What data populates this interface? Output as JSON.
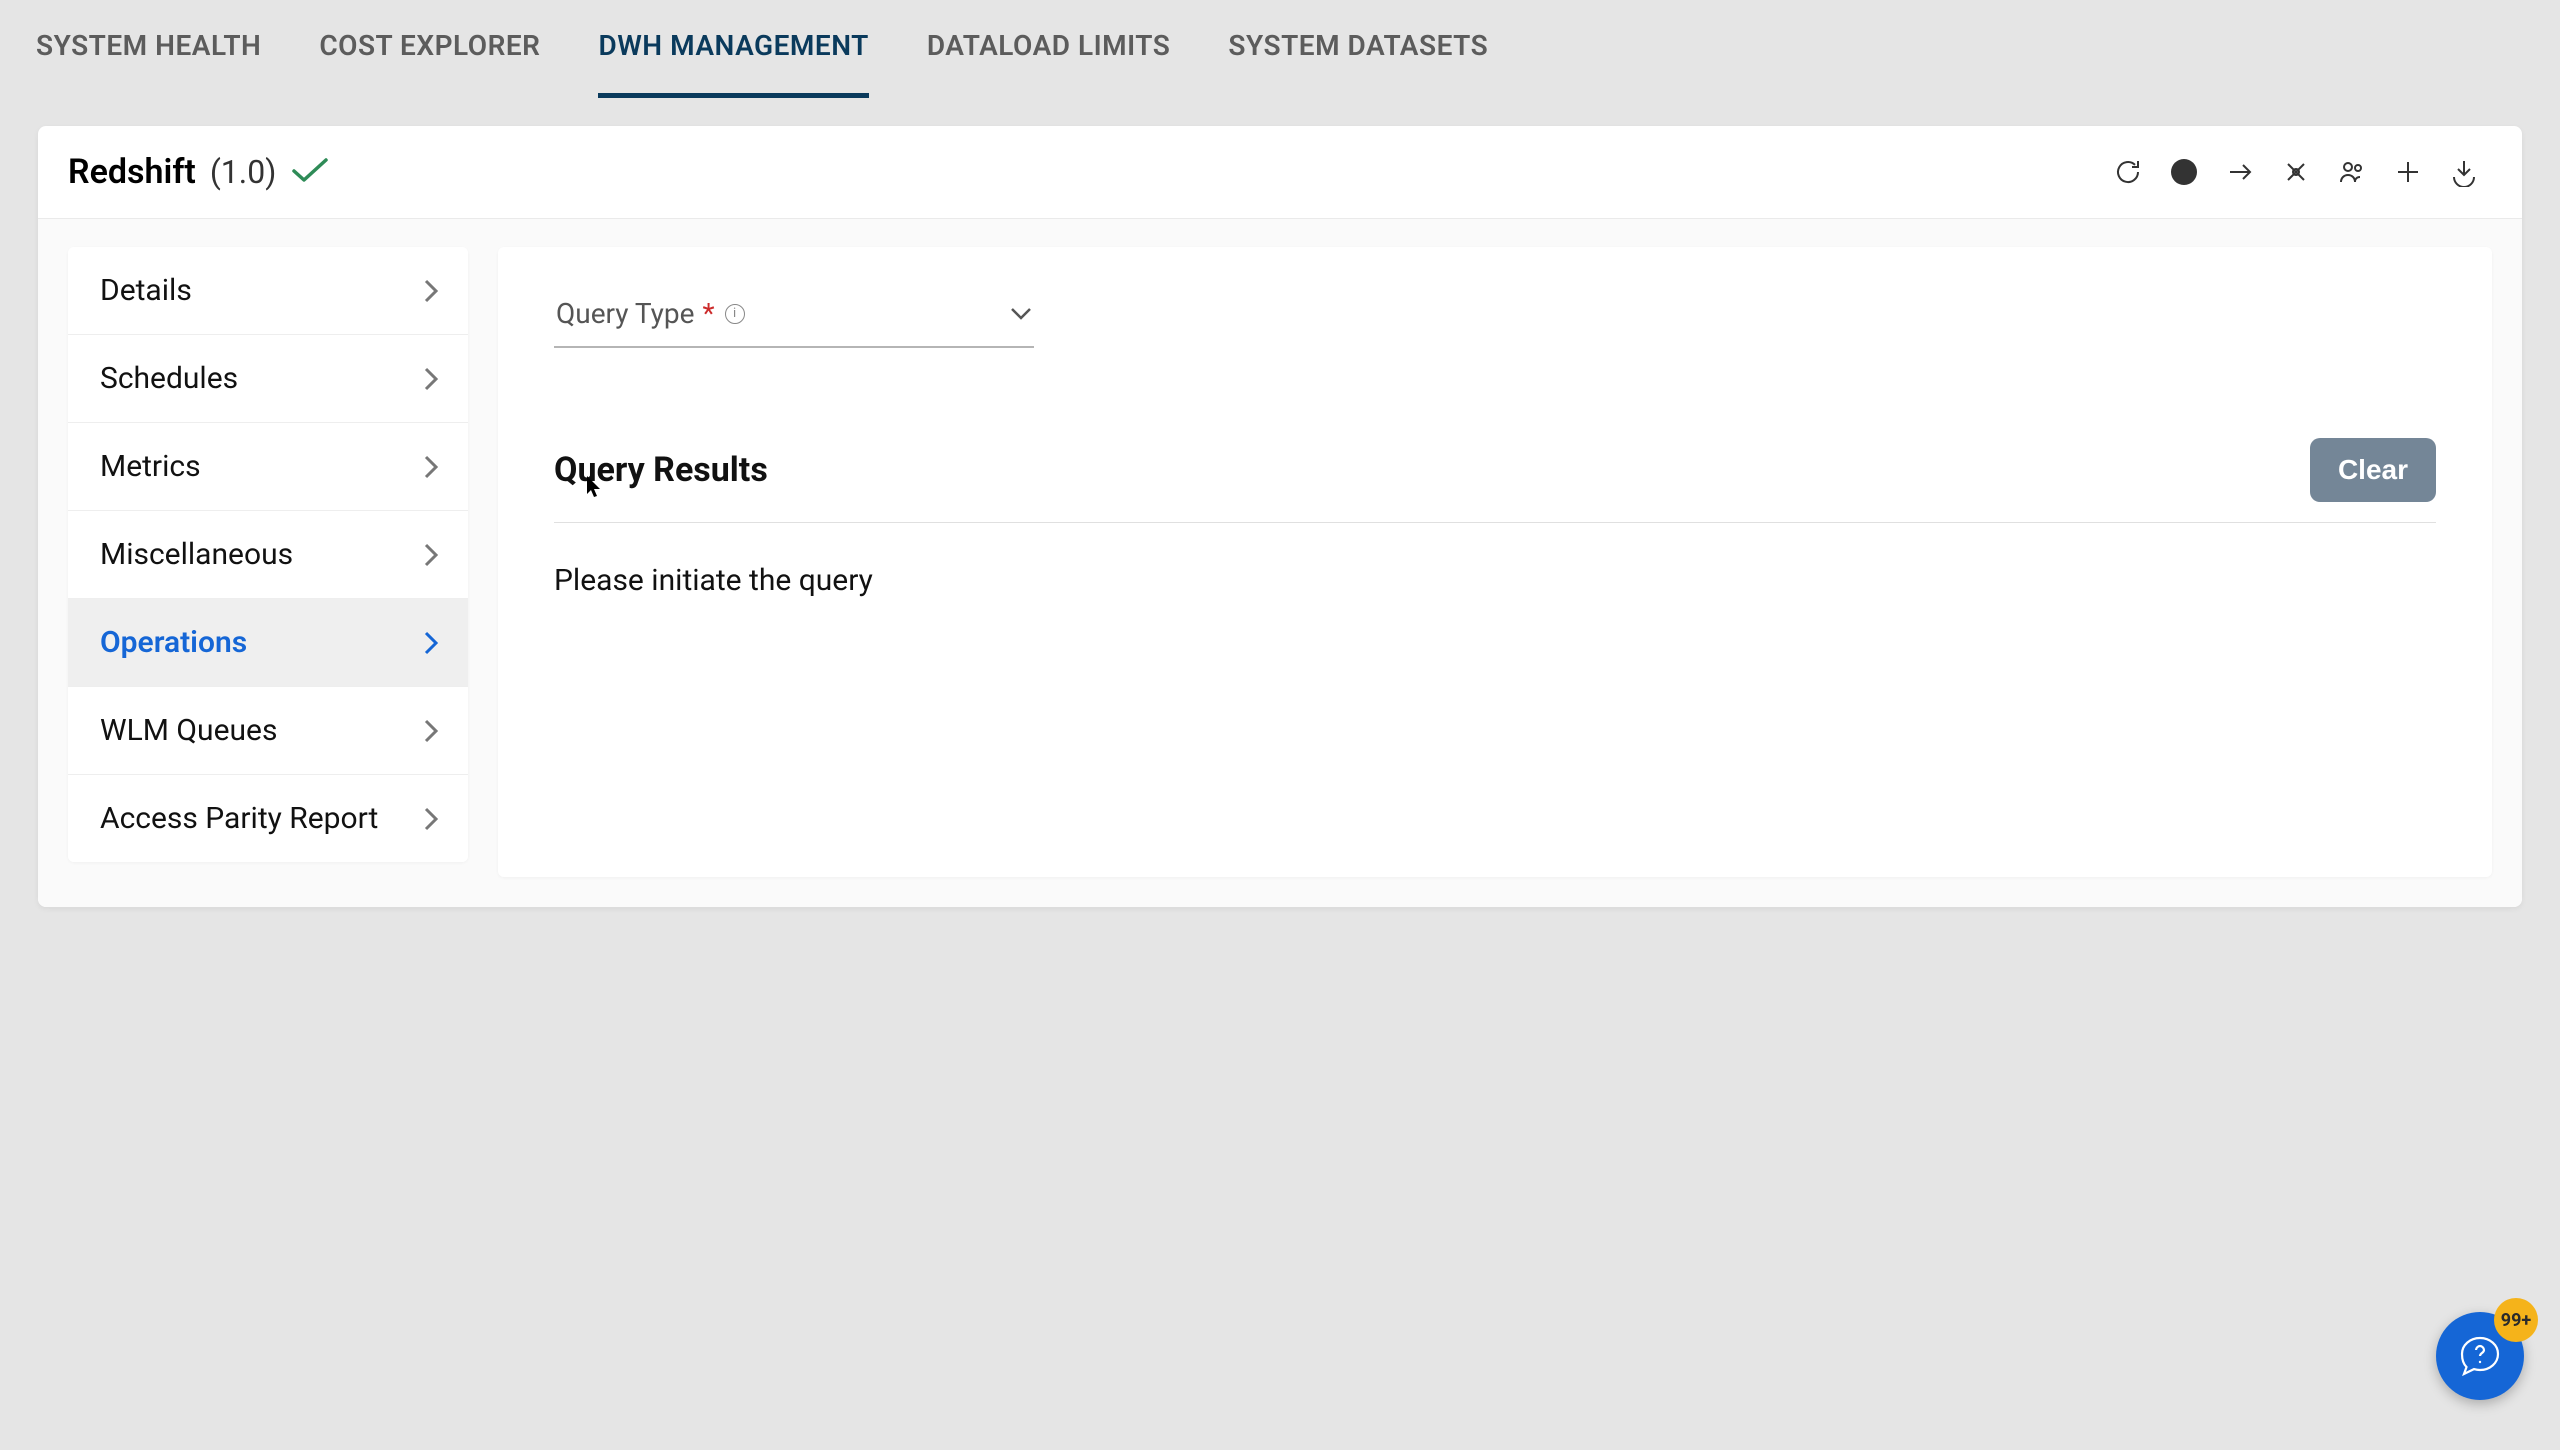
{
  "topTabs": {
    "items": [
      {
        "label": "SYSTEM HEALTH"
      },
      {
        "label": "COST EXPLORER"
      },
      {
        "label": "DWH MANAGEMENT"
      },
      {
        "label": "DATALOAD LIMITS"
      },
      {
        "label": "SYSTEM DATASETS"
      }
    ],
    "activeIndex": 2
  },
  "header": {
    "title": "Redshift",
    "version": "(1.0)",
    "toolbarIcons": [
      "refresh",
      "dot",
      "arrow-right",
      "tools",
      "users",
      "plus",
      "download"
    ]
  },
  "sidebar": {
    "items": [
      {
        "label": "Details"
      },
      {
        "label": "Schedules"
      },
      {
        "label": "Metrics"
      },
      {
        "label": "Miscellaneous"
      },
      {
        "label": "Operations"
      },
      {
        "label": "WLM Queues"
      },
      {
        "label": "Access Parity Report"
      }
    ],
    "activeIndex": 4
  },
  "content": {
    "queryType": {
      "label": "Query Type",
      "required": "*"
    },
    "results": {
      "title": "Query Results",
      "clear": "Clear",
      "emptyMessage": "Please initiate the query"
    }
  },
  "helpFab": {
    "badge": "99+"
  }
}
